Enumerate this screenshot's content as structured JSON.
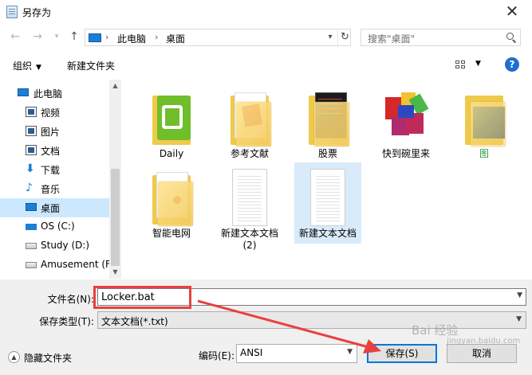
{
  "window": {
    "title": "另存为",
    "close_symbol": "✕"
  },
  "nav": {
    "address": {
      "crumbs": [
        "此电脑",
        "桌面"
      ],
      "separator": "›"
    },
    "search": {
      "placeholder": "搜索\"桌面\""
    }
  },
  "toolbar": {
    "organize": "组织",
    "new_folder": "新建文件夹",
    "help": "?"
  },
  "sidebar": {
    "items": [
      {
        "label": "此电脑",
        "icon": "computer-icon"
      },
      {
        "label": "视频",
        "icon": "video-icon"
      },
      {
        "label": "图片",
        "icon": "pictures-icon"
      },
      {
        "label": "文档",
        "icon": "documents-icon"
      },
      {
        "label": "下载",
        "icon": "download-icon"
      },
      {
        "label": "音乐",
        "icon": "music-icon"
      },
      {
        "label": "桌面",
        "icon": "desktop-icon",
        "selected": true
      },
      {
        "label": "OS (C:)",
        "icon": "windows-drive-icon"
      },
      {
        "label": "Study (D:)",
        "icon": "drive-icon"
      },
      {
        "label": "Amusement (F",
        "icon": "drive-icon"
      }
    ]
  },
  "files": [
    {
      "name": "Daily",
      "icon": "iqiyi-app-icon"
    },
    {
      "name": "参考文献",
      "icon": "folder-icon"
    },
    {
      "name": "股票",
      "icon": "folder-icon"
    },
    {
      "name": "快到碗里来",
      "icon": "blocks-app-icon"
    },
    {
      "name": "图",
      "icon": "folder-icon",
      "color": "#2a9d3f"
    },
    {
      "name": "智能电网",
      "icon": "folder-icon"
    },
    {
      "name": "新建文本文档",
      "name2": "(2)",
      "icon": "text-document-icon"
    },
    {
      "name": "新建文本文档",
      "icon": "text-document-icon",
      "selected": true
    }
  ],
  "form": {
    "filename_label": "文件名(N):",
    "filename_value": "Locker.bat",
    "filetype_label": "保存类型(T):",
    "filetype_value": "文本文档(*.txt)",
    "encoding_label": "编码(E):",
    "encoding_value": "ANSI"
  },
  "footer": {
    "hide_folders": "隐藏文件夹",
    "save": "保存(S)",
    "cancel": "取消"
  },
  "watermark": {
    "text": "Bai 经验",
    "sub": "jingyan.baidu.com"
  },
  "colors": {
    "selection": "#cce8ff",
    "accent": "#0078d7",
    "annotation": "#e8413e"
  }
}
